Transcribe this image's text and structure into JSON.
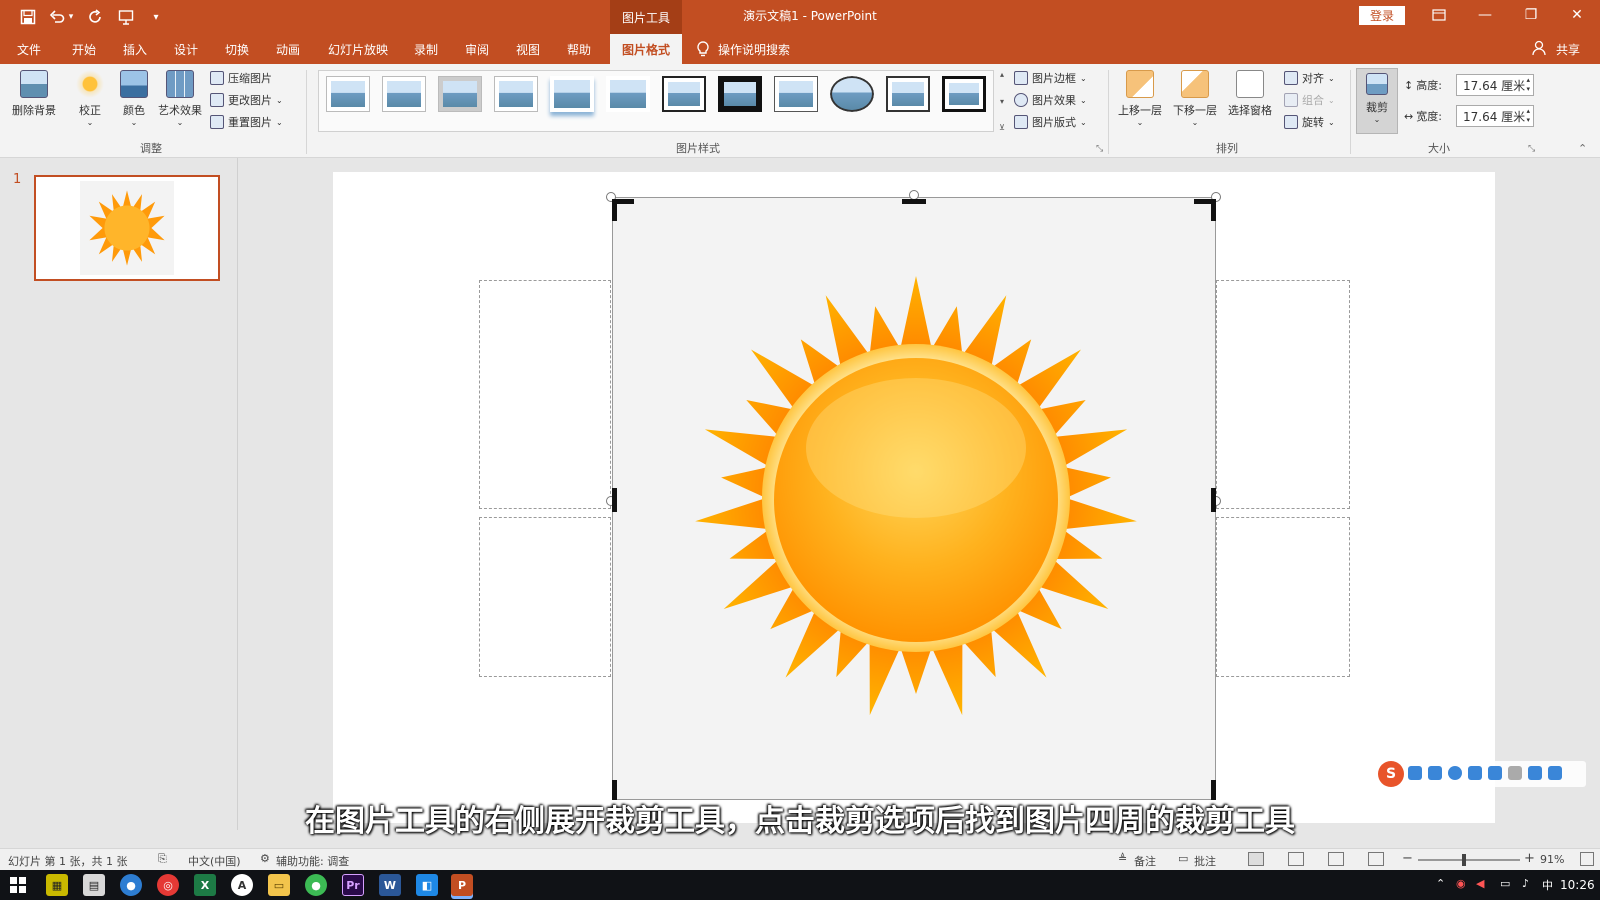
{
  "titlebar": {
    "context_group": "图片工具",
    "doc_title": "演示文稿1  -  PowerPoint",
    "login_label": "登录",
    "icons": [
      "save-icon",
      "undo-icon",
      "redo-icon",
      "customize-icon",
      "dropdown-icon"
    ]
  },
  "tabs": [
    {
      "label": "文件"
    },
    {
      "label": "开始"
    },
    {
      "label": "插入"
    },
    {
      "label": "设计"
    },
    {
      "label": "切换"
    },
    {
      "label": "动画"
    },
    {
      "label": "幻灯片放映"
    },
    {
      "label": "录制"
    },
    {
      "label": "审阅"
    },
    {
      "label": "视图"
    },
    {
      "label": "帮助"
    },
    {
      "label": "图片格式"
    }
  ],
  "tell_me": "操作说明搜索",
  "share_label": "共享",
  "ribbon": {
    "adjust": {
      "remove_bg": "删除背景",
      "corrections": "校正",
      "color": "颜色",
      "artistic": "艺术效果",
      "compress": "压缩图片",
      "change": "更改图片",
      "reset": "重置图片",
      "group_label": "调整"
    },
    "styles": {
      "group_label": "图片样式",
      "border": "图片边框",
      "effects": "图片效果",
      "layout": "图片版式"
    },
    "arrange": {
      "forward": "上移一层",
      "backward": "下移一层",
      "selection_pane": "选择窗格",
      "align": "对齐",
      "group": "组合",
      "rotate": "旋转",
      "group_label": "排列"
    },
    "size": {
      "crop": "裁剪",
      "height_label": "高度:",
      "height_value": "17.64 厘米",
      "width_label": "宽度:",
      "width_value": "17.64 厘米",
      "group_label": "大小"
    }
  },
  "thumbnail": {
    "number": "1"
  },
  "caption": "在图片工具的右侧展开裁剪工具，点击裁剪选项后找到图片四周的裁剪工具",
  "statusbar": {
    "slide_info": "幻灯片 第 1 张，共 1 张",
    "language": "中文(中国)",
    "accessibility": "辅助功能: 调查",
    "notes": "备注",
    "comments": "批注",
    "zoom": "91%"
  },
  "taskbar": {
    "time": "10:26"
  },
  "colors": {
    "accent": "#c24e22",
    "sun_core": "#ffb020",
    "sun_rays": "#ff8c00"
  }
}
